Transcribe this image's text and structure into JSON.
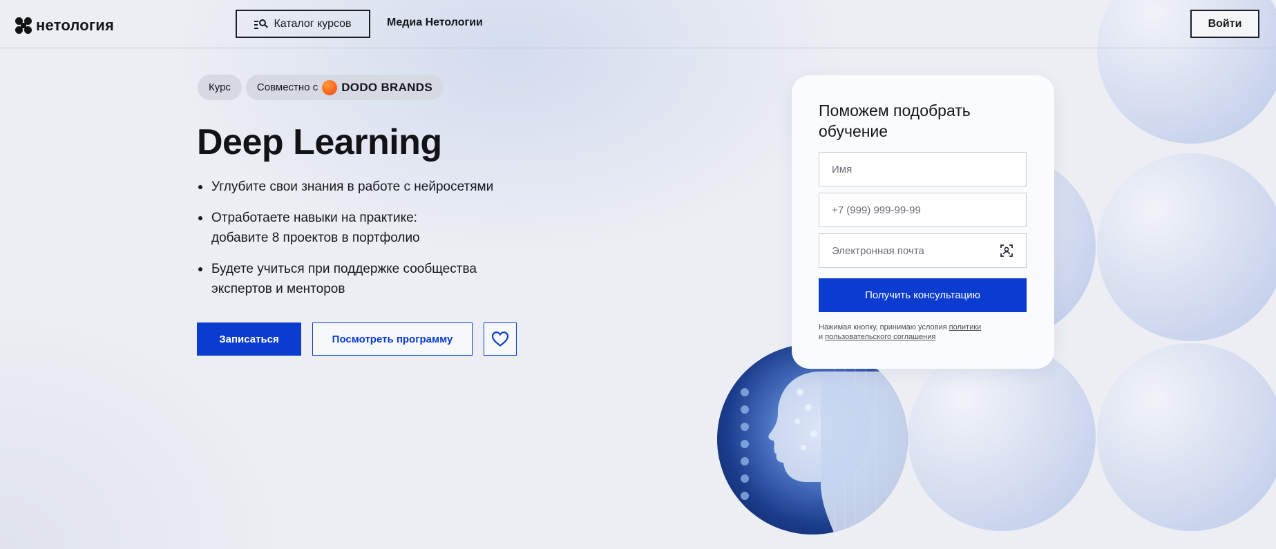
{
  "header": {
    "logo_text": "нетология",
    "catalog_label": "Каталог курсов",
    "media_label": "Медиа Нетологии",
    "login_label": "Войти"
  },
  "hero": {
    "tag_course": "Курс",
    "tag_partner_prefix": "Совместно с",
    "partner_name": "DODO BRANDS",
    "title": "Deep Learning",
    "bullets": [
      "Углубите свои знания в работе с нейросетями",
      "Отработаете навыки на практике: добавите 8 проектов в портфолио",
      "Будете учиться при поддержке сообщества экспертов и менторов"
    ],
    "enroll_label": "Записаться",
    "program_label": "Посмотреть программу"
  },
  "form": {
    "title": "Поможем подобрать обучение",
    "name_placeholder": "Имя",
    "phone_placeholder": "+7 (999) 999-99-99",
    "email_placeholder": "Электронная почта",
    "submit_label": "Получить консультацию",
    "disclaimer_prefix": "Нажимая кнопку, принимаю условия",
    "policy_link": "политики",
    "disclaimer_and": "и",
    "agreement_link": "пользовательского соглашения"
  },
  "colors": {
    "accent": "#0b3ccf",
    "background": "#eceef3",
    "card": "#fafbfc",
    "partner_logo": "#ff6a1f"
  },
  "icons": {
    "catalog": "catalog-search-icon",
    "heart": "heart-icon",
    "autofill": "autofill-icon",
    "logo": "netology-logo-icon",
    "partner": "dodo-logo-icon"
  }
}
